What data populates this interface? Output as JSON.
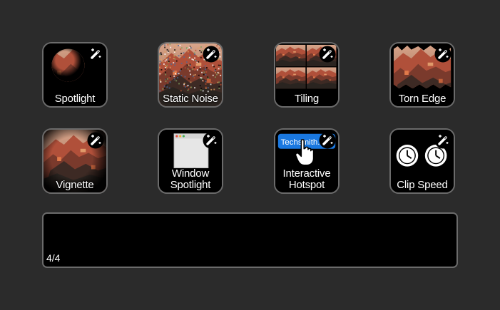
{
  "effects": [
    {
      "id": "spotlight",
      "label_1": "Spotlight",
      "label_2": "",
      "icon": "magic-wand-icon"
    },
    {
      "id": "static-noise",
      "label_1": "Static Noise",
      "label_2": "",
      "icon": "magic-wand-icon"
    },
    {
      "id": "tiling",
      "label_1": "Tiling",
      "label_2": "",
      "icon": "magic-wand-icon"
    },
    {
      "id": "torn-edge",
      "label_1": "Torn Edge",
      "label_2": "",
      "icon": "magic-wand-icon"
    },
    {
      "id": "vignette",
      "label_1": "Vignette",
      "label_2": "",
      "icon": "magic-wand-icon"
    },
    {
      "id": "window-spotlight",
      "label_1": "Window",
      "label_2": "Spotlight",
      "icon": "magic-wand-icon"
    },
    {
      "id": "interactive-hotspot",
      "label_1": "Interactive",
      "label_2": "Hotspot",
      "icon": "magic-wand-icon",
      "thumb_text": "Techsmith.c"
    },
    {
      "id": "clip-speed",
      "label_1": "Clip Speed",
      "label_2": "",
      "icon": "magic-wand-icon"
    }
  ],
  "panel": {
    "counter": "4/4"
  },
  "colors": {
    "background": "#2b2b2b",
    "tile_bg": "#000000",
    "tile_border": "#6b6b6b",
    "hotspot_blue": "#1a78e0"
  }
}
